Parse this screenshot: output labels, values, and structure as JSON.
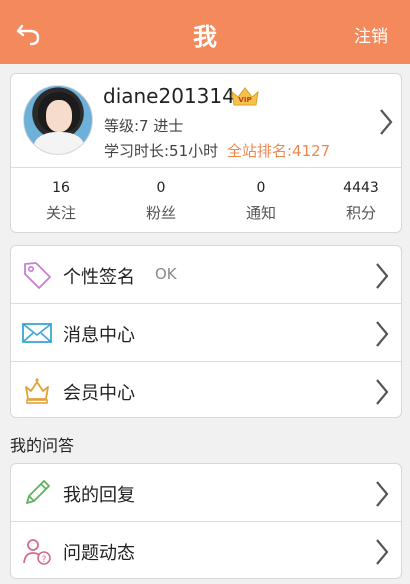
{
  "header": {
    "title": "我",
    "logout_label": "注销"
  },
  "profile": {
    "username": "diane201314",
    "level": "等级:7 进士",
    "study_time": "学习时长:51小时",
    "rank": "全站排名:4127",
    "vip_label": "VIP",
    "stats": [
      {
        "value": "16",
        "label": "关注"
      },
      {
        "value": "0",
        "label": "粉丝"
      },
      {
        "value": "0",
        "label": "通知"
      },
      {
        "value": "4443",
        "label": "积分"
      }
    ]
  },
  "menu": {
    "signature_label": "个性签名",
    "signature_value": "OK",
    "messages_label": "消息中心",
    "member_label": "会员中心"
  },
  "qa_section": {
    "title": "我的问答",
    "my_replies_label": "我的回复",
    "question_activity_label": "问题动态"
  },
  "icons": {
    "back": "back-arrow-icon",
    "vip": "vip-crown-icon",
    "signature": "tag-icon",
    "messages": "envelope-icon",
    "member": "crown-icon",
    "replies": "pencil-icon",
    "questions": "user-question-icon",
    "chevron": "chevron-right-icon"
  },
  "colors": {
    "accent": "#f48a5b",
    "rank": "#f0884e"
  }
}
